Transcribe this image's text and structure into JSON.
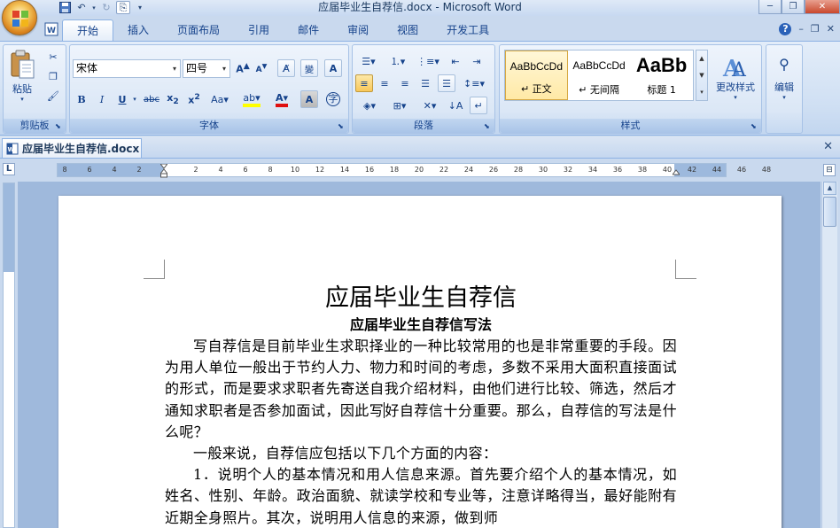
{
  "window": {
    "title": "应届毕业生自荐信.docx - Microsoft Word",
    "minimize": "─",
    "restore": "❐",
    "close": "✕"
  },
  "qat": [
    "save-icon",
    "undo-icon",
    "redo-icon",
    "paste-icon",
    "customize-icon"
  ],
  "ribbon_tabs": [
    {
      "label": "开始",
      "active": true
    },
    {
      "label": "插入"
    },
    {
      "label": "页面布局"
    },
    {
      "label": "引用"
    },
    {
      "label": "邮件"
    },
    {
      "label": "审阅"
    },
    {
      "label": "视图"
    },
    {
      "label": "开发工具"
    }
  ],
  "ribbon_right": {
    "help": "?",
    "min": "–",
    "restore": "❐",
    "close": "✕"
  },
  "groups": {
    "clipboard": {
      "label": "剪贴板",
      "paste": "粘贴"
    },
    "font": {
      "label": "字体",
      "font_name": "宋体",
      "font_size": "四号"
    },
    "paragraph": {
      "label": "段落"
    },
    "styles": {
      "label": "样式",
      "items": [
        {
          "sample": "AaBbCcDd",
          "name": "↵ 正文",
          "active": true
        },
        {
          "sample": "AaBbCcDd",
          "name": "↵ 无间隔"
        },
        {
          "sample": "AaBb",
          "name": "标题 1"
        }
      ],
      "change_styles": "更改样式"
    },
    "editing": {
      "label": "编辑"
    }
  },
  "document_tab": {
    "label": "应届毕业生自荐信.docx"
  },
  "ruler": {
    "corner": "L",
    "ticks": [
      "8",
      "6",
      "4",
      "2",
      "2",
      "4",
      "6",
      "8",
      "10",
      "12",
      "14",
      "16",
      "18",
      "20",
      "22",
      "24",
      "26",
      "28",
      "30",
      "32",
      "34",
      "36",
      "38",
      "40",
      "42",
      "44",
      "46",
      "48"
    ]
  },
  "document": {
    "title": "应届毕业生自荐信",
    "subtitle": "应届毕业生自荐信写法",
    "para1_part1": "写自荐信是目前毕业生求职择业的一种比较常用的也是非常重要的手段。因为用人单位一般出于节约人力、物力和时间的考虑，多数不采用大面积直接面试的形式，而是要求求职者先寄送自我介绍材料，由他们进行比较、筛选，然后才通知求职者是否参加面试，因此写",
    "para1_part2": "好自荐信十分重要。那么，自荐信的写法是什么呢？",
    "para2": "一般来说，自荐信应包括以下几个方面的内容：",
    "para3": "1．说明个人的基本情况和用人信息来源。首先要介绍个人的基本情况，如姓名、性别、年龄。政治面貌、就读学校和专业等，注意详略得当，最好能附有近期全身照片。其次，说明用人信息的来源，做到师"
  }
}
